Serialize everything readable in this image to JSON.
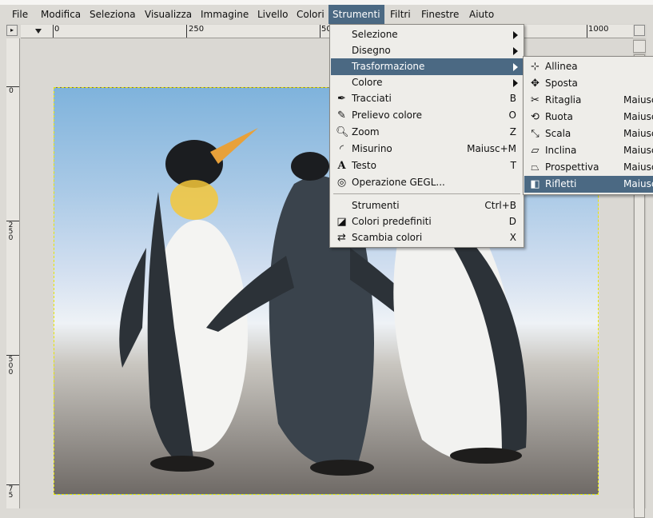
{
  "menubar": {
    "items": [
      {
        "label": "File"
      },
      {
        "label": "Modifica"
      },
      {
        "label": "Seleziona"
      },
      {
        "label": "Visualizza"
      },
      {
        "label": "Immagine"
      },
      {
        "label": "Livello"
      },
      {
        "label": "Colori"
      },
      {
        "label": "Strumenti",
        "active": true
      },
      {
        "label": "Filtri"
      },
      {
        "label": "Finestre"
      },
      {
        "label": "Aiuto"
      }
    ]
  },
  "ruler": {
    "horizontal_labels": [
      "0",
      "250",
      "50",
      "1000"
    ],
    "vertical_labels": [
      "0",
      "250",
      "500",
      "75"
    ]
  },
  "tools_menu": {
    "items": [
      {
        "label": "Selezione",
        "submenu": true
      },
      {
        "label": "Disegno",
        "submenu": true
      },
      {
        "label": "Trasformazione",
        "submenu": true,
        "highlighted": true
      },
      {
        "label": "Colore",
        "submenu": true
      },
      {
        "label": "Tracciati",
        "accel": "B",
        "icon": "path-icon"
      },
      {
        "label": "Prelievo colore",
        "accel": "O",
        "icon": "color-picker-icon"
      },
      {
        "label": "Zoom",
        "accel": "Z",
        "icon": "zoom-icon"
      },
      {
        "label": "Misurino",
        "accel": "Maiusc+M",
        "icon": "measure-icon"
      },
      {
        "label": "Testo",
        "accel": "T",
        "icon": "text-icon"
      },
      {
        "label": "Operazione GEGL...",
        "icon": "gegl-icon"
      },
      {
        "label": "Strumenti",
        "accel": "Ctrl+B"
      },
      {
        "label": "Colori predefiniti",
        "accel": "D",
        "icon": "default-colors-icon"
      },
      {
        "label": "Scambia colori",
        "accel": "X",
        "icon": "swap-colors-icon"
      }
    ]
  },
  "transform_menu": {
    "items": [
      {
        "label": "Allinea",
        "accel": "",
        "icon": "align-icon"
      },
      {
        "label": "Sposta",
        "accel": "",
        "icon": "move-icon"
      },
      {
        "label": "Ritaglia",
        "accel": "Maiusc",
        "icon": "crop-icon"
      },
      {
        "label": "Ruota",
        "accel": "Maiusc",
        "icon": "rotate-icon"
      },
      {
        "label": "Scala",
        "accel": "Maiusc",
        "icon": "scale-icon"
      },
      {
        "label": "Inclina",
        "accel": "Maiusc",
        "icon": "shear-icon"
      },
      {
        "label": "Prospettiva",
        "accel": "Maiusc",
        "icon": "perspective-icon"
      },
      {
        "label": "Rifletti",
        "accel": "Maiusc",
        "icon": "flip-icon",
        "highlighted": true
      }
    ]
  },
  "colors": {
    "highlight": "#4b6983",
    "menu_bg": "#eeede9",
    "window_bg": "#dcdad5"
  }
}
